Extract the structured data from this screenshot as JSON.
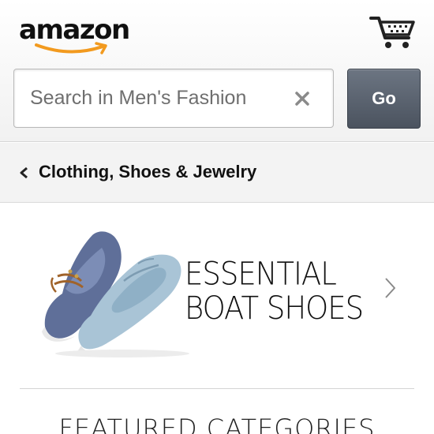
{
  "header": {
    "logo_text": "amazon",
    "cart_icon": "cart-icon"
  },
  "search": {
    "placeholder": "Search in Men's Fashion",
    "value": "",
    "clear_icon": "close-icon",
    "go_label": "Go"
  },
  "breadcrumb": {
    "back_icon": "chevron-left-icon",
    "label": "Clothing, Shoes & Jewelry"
  },
  "banner": {
    "title_line1": "ESSENTIAL",
    "title_line2": "BOAT SHOES",
    "image": "boat-shoes-image",
    "chevron_icon": "chevron-right-icon"
  },
  "featured": {
    "heading": "FEATURED CATEGORIES"
  },
  "colors": {
    "logo_smile": "#f29a1f",
    "go_button": "#555d69",
    "header_bg": "#f4f4f4"
  }
}
